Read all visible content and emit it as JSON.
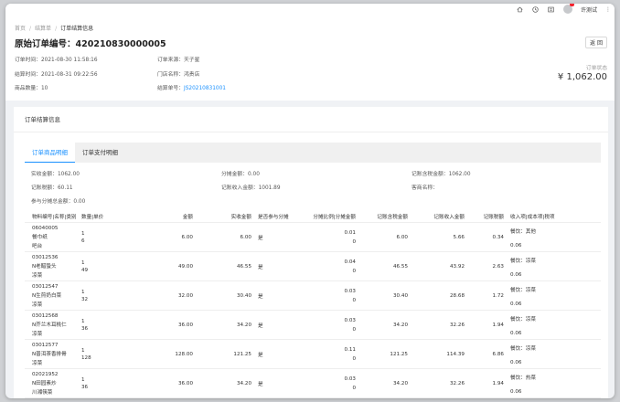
{
  "topbar": {
    "icons": [
      "home-icon",
      "clock-icon",
      "list-icon",
      "avatar"
    ],
    "username": "许测试",
    "menu_glyph": "⋮"
  },
  "header": {
    "breadcrumb": [
      "首页",
      "结算单",
      "订单结算信息"
    ],
    "title": "原始订单编号：420210830000005",
    "back_label": "返 回",
    "info": {
      "order_time": "订单时间：2021-08-30 11:58:16",
      "settle_time": "结算时间：2021-08-31 09:22:56",
      "item_count": "商品数量：10",
      "source": "订单来源：天子星",
      "store": "门店名称：鸿贵店",
      "settle_no_label": "结算单号：",
      "settle_no": "JS20210831001"
    },
    "status_label": "订单状态",
    "amount": "¥ 1,062.00"
  },
  "content": {
    "section_title": "订单结算信息",
    "tabs": [
      "订单商品明细",
      "订单支付明细"
    ],
    "summary": [
      "实收金额：1062.00",
      "分摊金额：0.00",
      "记账含税金额：1062.00",
      "记账税额：60.11",
      "记账收入金额：1001.89",
      "客商名称：",
      "参与分摊总金额：0.00"
    ],
    "table": {
      "headers": [
        "物料编号|名称|类别",
        "数量|单价",
        "金额",
        "实收金额",
        "是否参与分摊",
        "分摊比例|分摊金额",
        "记账含税金额",
        "记账收入金额",
        "记账税额",
        "收入项|成本项|税项"
      ],
      "rows": [
        {
          "code": "06040005",
          "name": "餐巾纸",
          "cat": "吧台",
          "qty": "1",
          "price": "6",
          "amount": "6.00",
          "paid": "6.00",
          "share": "是",
          "ratio": "0.01",
          "share_amt": "0",
          "tax_incl": "6.00",
          "income": "5.66",
          "tax": "0.34",
          "income_item": "餐饮：其他",
          "tax_rate": "0.06"
        },
        {
          "code": "03012536",
          "name": "N老醋蛰头",
          "cat": "凉菜",
          "qty": "1",
          "price": "49",
          "amount": "49.00",
          "paid": "46.55",
          "share": "是",
          "ratio": "0.04",
          "share_amt": "0",
          "tax_incl": "46.55",
          "income": "43.92",
          "tax": "2.63",
          "income_item": "餐饮：凉菜",
          "tax_rate": "0.06"
        },
        {
          "code": "03012547",
          "name": "N生煎奶白菜",
          "cat": "凉菜",
          "qty": "1",
          "price": "32",
          "amount": "32.00",
          "paid": "30.40",
          "share": "是",
          "ratio": "0.03",
          "share_amt": "0",
          "tax_incl": "30.40",
          "income": "28.68",
          "tax": "1.72",
          "income_item": "餐饮：凉菜",
          "tax_rate": "0.06"
        },
        {
          "code": "03012568",
          "name": "N芥兰木耳桃仁",
          "cat": "凉菜",
          "qty": "1",
          "price": "36",
          "amount": "36.00",
          "paid": "34.20",
          "share": "是",
          "ratio": "0.03",
          "share_amt": "0",
          "tax_incl": "34.20",
          "income": "32.26",
          "tax": "1.94",
          "income_item": "餐饮：凉菜",
          "tax_rate": "0.06"
        },
        {
          "code": "03012577",
          "name": "N普洱茶香排骨",
          "cat": "凉菜",
          "qty": "1",
          "price": "128",
          "amount": "128.00",
          "paid": "121.25",
          "share": "是",
          "ratio": "0.11",
          "share_amt": "0",
          "tax_incl": "121.25",
          "income": "114.39",
          "tax": "6.86",
          "income_item": "餐饮：凉菜",
          "tax_rate": "0.06"
        },
        {
          "code": "02021952",
          "name": "N田园素炒",
          "cat": "川湘筷菜",
          "qty": "1",
          "price": "36",
          "amount": "36.00",
          "paid": "34.20",
          "share": "是",
          "ratio": "0.03",
          "share_amt": "0",
          "tax_incl": "34.20",
          "income": "32.26",
          "tax": "1.94",
          "income_item": "餐饮：热菜",
          "tax_rate": "0.06"
        }
      ]
    }
  }
}
